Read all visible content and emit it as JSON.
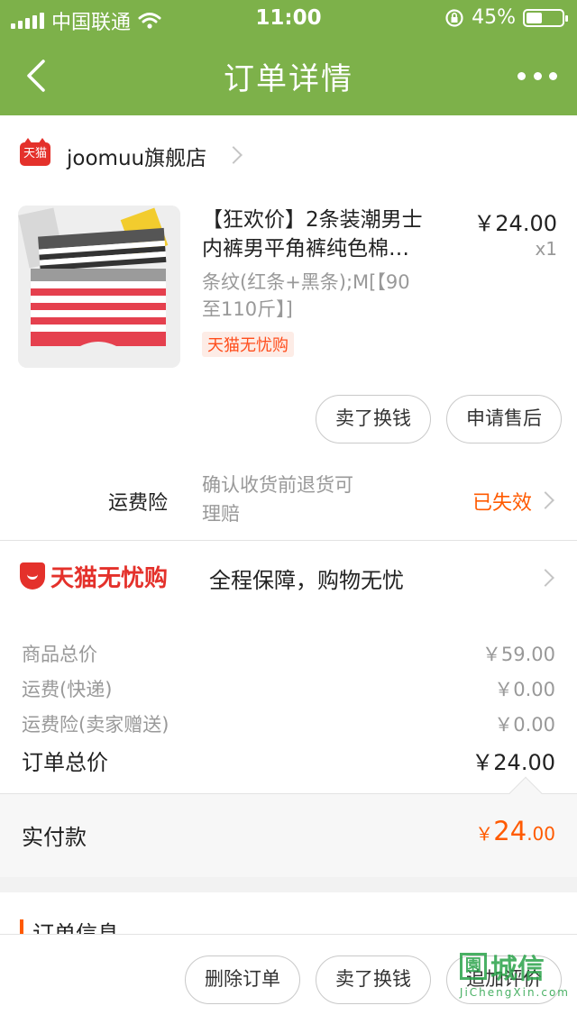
{
  "status_bar": {
    "carrier": "中国联通",
    "time": "11:00",
    "battery": "45%",
    "battery_level": 0.45
  },
  "nav": {
    "title": "订单详情",
    "back_icon": "chevron-left-icon",
    "more_icon": "more-dots-icon"
  },
  "store": {
    "badge": "天猫",
    "name": "joomuu旗舰店"
  },
  "product": {
    "title_line1": "【狂欢价】2条装潮男士",
    "title_line2": "内裤男平角裤纯色棉…",
    "price": "￥24.00",
    "qty": "x1",
    "sku_line1": "条纹(红条+黑条);M[【90",
    "sku_line2": "至110斤】]",
    "tag": "天猫无忧购"
  },
  "item_actions": {
    "sell": "卖了换钱",
    "after_sale": "申请售后"
  },
  "insurance": {
    "label": "运费险",
    "desc_line1": "确认收货前退货可",
    "desc_line2": "理赔",
    "status": "已失效"
  },
  "worry_free": {
    "logo": "天猫无忧购",
    "text": "全程保障，购物无忧"
  },
  "fees": [
    {
      "label": "商品总价",
      "value": "￥59.00"
    },
    {
      "label": "运费(快递)",
      "value": "￥0.00"
    },
    {
      "label": "运费险(卖家赠送)",
      "value": "￥0.00"
    }
  ],
  "order_total": {
    "label": "订单总价",
    "value": "￥24.00"
  },
  "paid": {
    "label": "实付款",
    "symbol": "￥",
    "integer": "24",
    "decimal": ".00"
  },
  "order_info": {
    "title": "订单信息"
  },
  "bottom_actions": {
    "delete": "删除订单",
    "sell": "卖了换钱",
    "review": "追加评价"
  },
  "watermark": {
    "text": "城信",
    "url": "JiChengXin.com"
  },
  "colors": {
    "header": "#7db14a",
    "accent": "#ff5a00",
    "tmall_red": "#e4312b"
  }
}
